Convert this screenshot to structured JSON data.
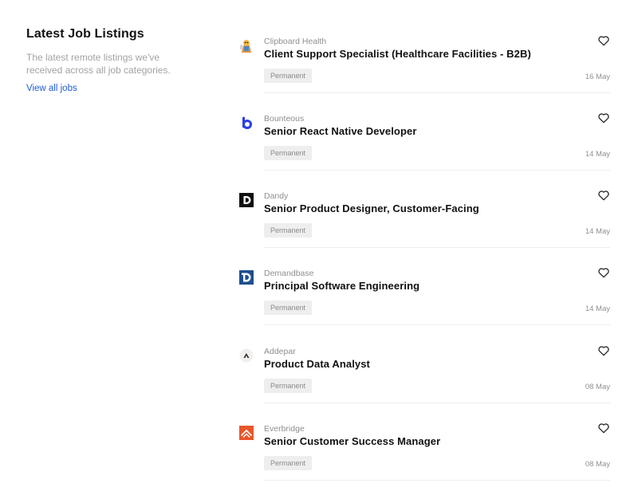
{
  "sidebar": {
    "title": "Latest Job Listings",
    "description": "The latest remote listings we've received across all job categories.",
    "view_all": "View all jobs"
  },
  "jobs": [
    {
      "company": "Clipboard Health",
      "title": "Client Support Specialist (Healthcare Facilities - B2B)",
      "tag": "Permanent",
      "date": "16 May",
      "logo": "clipboard-health-logo"
    },
    {
      "company": "Bounteous",
      "title": "Senior React Native Developer",
      "tag": "Permanent",
      "date": "14 May",
      "logo": "bounteous-logo"
    },
    {
      "company": "Dandy",
      "title": "Senior Product Designer, Customer-Facing",
      "tag": "Permanent",
      "date": "14 May",
      "logo": "dandy-logo"
    },
    {
      "company": "Demandbase",
      "title": "Principal Software Engineering",
      "tag": "Permanent",
      "date": "14 May",
      "logo": "demandbase-logo"
    },
    {
      "company": "Addepar",
      "title": "Product Data Analyst",
      "tag": "Permanent",
      "date": "08 May",
      "logo": "addepar-logo"
    },
    {
      "company": "Everbridge",
      "title": "Senior Customer Success Manager",
      "tag": "Permanent",
      "date": "08 May",
      "logo": "everbridge-logo"
    }
  ],
  "icons": {
    "favorite": "heart-outline-icon"
  },
  "colors": {
    "link": "#1f5bd8",
    "bounteous": "#2b3de8",
    "dandy": "#111111",
    "demandbase": "#1e4f8f",
    "everbridge": "#e8562a"
  }
}
